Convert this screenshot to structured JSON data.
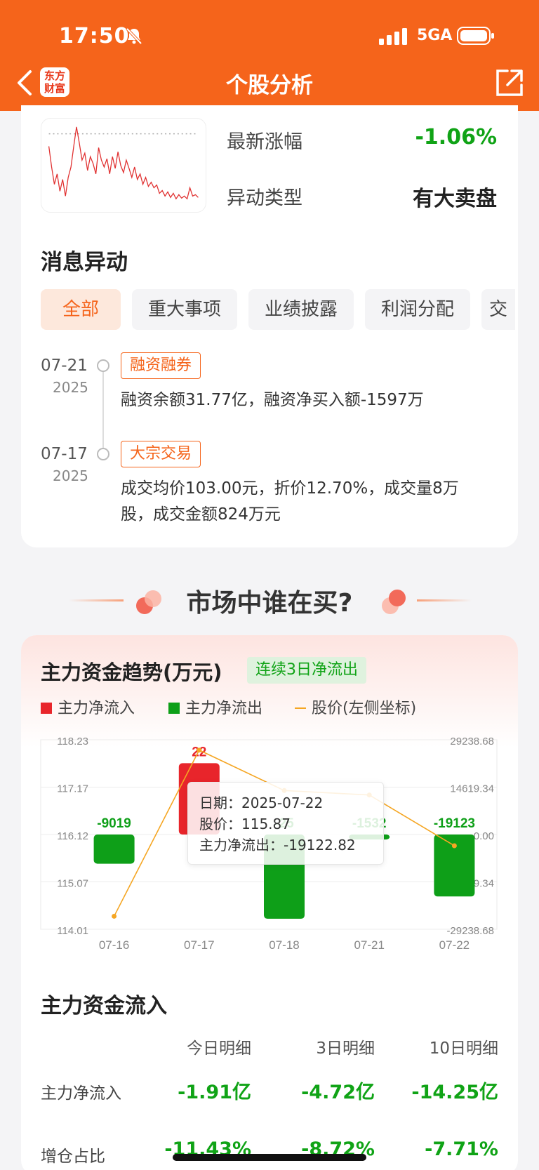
{
  "status_bar": {
    "time": "17:50",
    "network": "5GA"
  },
  "nav": {
    "logo_text": "东方财富",
    "title": "个股分析"
  },
  "summary": {
    "rows": [
      {
        "label": "最新涨幅",
        "value": "-1.06%"
      },
      {
        "label": "异动类型",
        "value": "有大卖盘"
      }
    ]
  },
  "news": {
    "title": "消息异动",
    "tabs": [
      "全部",
      "重大事项",
      "业绩披露",
      "利润分配",
      "交"
    ],
    "items": [
      {
        "date": "07-21",
        "year": "2025",
        "tag": "融资融券",
        "text": "融资余额31.77亿，融资净买入额-1597万"
      },
      {
        "date": "07-17",
        "year": "2025",
        "tag": "大宗交易",
        "text": "成交均价103.00元，折价12.70%，成交量8万股，成交金额824万元"
      }
    ]
  },
  "banner": {
    "title": "市场中谁在买?"
  },
  "capital_trend": {
    "title": "主力资金趋势(万元)",
    "badge": "连续3日净流出",
    "legend": {
      "inflow": "主力净流入",
      "outflow": "主力净流出",
      "price": "股价(左侧坐标)"
    },
    "tooltip": {
      "date": "日期：2025-07-22",
      "price": "股价：115.87",
      "flow": "主力净流出：-19122.82"
    }
  },
  "chart_data": {
    "type": "bar",
    "categories": [
      "07-16",
      "07-17",
      "07-18",
      "07-21",
      "07-22"
    ],
    "series": [
      {
        "name": "主力净流入",
        "values": [
          -9019,
          22000,
          -26000,
          -1532,
          -19123
        ]
      },
      {
        "name": "股价(左侧坐标)",
        "values": [
          114.3,
          118.0,
          117.1,
          117.0,
          115.87
        ]
      }
    ],
    "value_labels": [
      "-9019",
      "22",
      "-25",
      "-1532",
      "-19123"
    ],
    "y_left_ticks": [
      "118.23",
      "117.17",
      "116.12",
      "115.07",
      "114.01"
    ],
    "y_left_range": [
      114.01,
      118.23
    ],
    "y_right_ticks": [
      "29238.68",
      "14619.34",
      "0.00",
      "-14619.34",
      "-29238.68"
    ],
    "y_right_range": [
      -29238.68,
      29238.68
    ],
    "colors": {
      "inflow": "#e8252b",
      "outflow": "#0e9f18",
      "price": "#f5a623"
    },
    "grid": true
  },
  "capital_flow": {
    "title": "主力资金流入",
    "columns": [
      "今日明细",
      "3日明细",
      "10日明细"
    ],
    "rows": [
      {
        "label": "主力净流入",
        "values": [
          "-1.91亿",
          "-4.72亿",
          "-14.25亿"
        ]
      },
      {
        "label": "增仓占比",
        "values": [
          "-11.43%",
          "-8.72%",
          "-7.71%"
        ]
      }
    ]
  }
}
